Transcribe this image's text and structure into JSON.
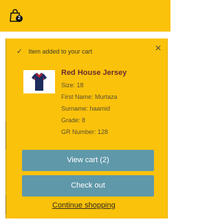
{
  "header": {
    "cart_count": "2",
    "cart_icon_name": "shopping-bag-icon"
  },
  "notification": {
    "check_icon_name": "check-icon",
    "message": "Item added to your cart",
    "close_icon": "×",
    "close_icon_name": "close-icon"
  },
  "product": {
    "image_icon_name": "jersey-icon",
    "title": "Red House Jersey",
    "details": [
      "Size: 18",
      "First Name: Murtaza",
      "Surname: haamid",
      "Grade: 8",
      "GR Number: 128"
    ]
  },
  "actions": {
    "view_cart_label": "View cart (2)",
    "checkout_label": "Check out",
    "continue_label": "Continue shopping"
  },
  "colors": {
    "panel_yellow": "#FBC20B",
    "button_teal": "#5F98A9",
    "title_brown": "#6B2C2C"
  }
}
